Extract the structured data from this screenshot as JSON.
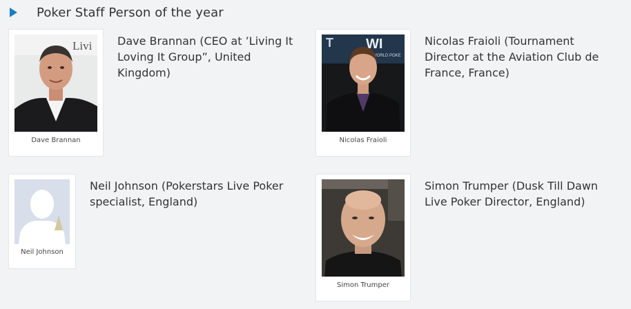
{
  "section": {
    "title": "Poker Staff Person of the year"
  },
  "nominees": [
    {
      "caption": "Dave Brannan",
      "description": "Dave Brannan (CEO at ’Living It Loving It Group”, United Kingdom)",
      "photo_text": "Livi"
    },
    {
      "caption": "Nicolas Fraioli",
      "description": "Nicolas Fraioli (Tournament Director at the Aviation Club de France, France)",
      "photo_text": "WORLD POKE"
    },
    {
      "caption": "Neil Johnson",
      "description": "Neil Johnson (Pokerstars Live Poker specialist, England)"
    },
    {
      "caption": "Simon Trumper",
      "description": "Simon Trumper (Dusk Till Dawn Live Poker Director, England)"
    }
  ]
}
